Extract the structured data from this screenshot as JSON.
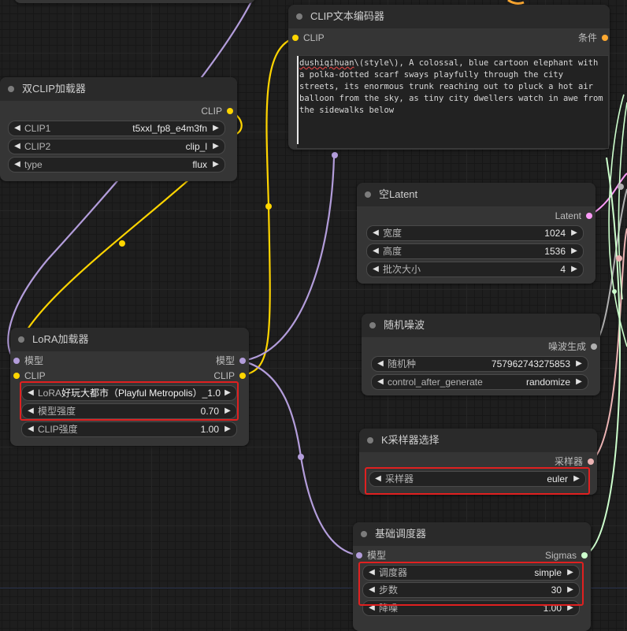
{
  "nodes": {
    "clip_text_encoder": {
      "title": "CLIP文本编码器",
      "input_clip": "CLIP",
      "output_cond": "条件",
      "prompt_keyword": "dushiqihuan",
      "prompt_rest": "\\(style\\), A colossal, blue cartoon elephant with a polka-dotted scarf sways playfully through the city streets, its enormous trunk reaching out to pluck a hot air balloon from the sky, as tiny city dwellers watch in awe from the sidewalks below"
    },
    "dual_clip_loader": {
      "title": "双CLIP加载器",
      "output_clip": "CLIP",
      "clip1_label": "CLIP1",
      "clip1_value": "t5xxl_fp8_e4m3fn",
      "clip2_label": "CLIP2",
      "clip2_value": "clip_l",
      "type_label": "type",
      "type_value": "flux"
    },
    "empty_latent": {
      "title": "空Latent",
      "output_latent": "Latent",
      "width_label": "宽度",
      "width_value": "1024",
      "height_label": "高度",
      "height_value": "1536",
      "batch_label": "批次大小",
      "batch_value": "4"
    },
    "random_noise": {
      "title": "随机噪波",
      "output_noise": "噪波生成",
      "seed_label": "随机种",
      "seed_value": "757962743275853",
      "control_label": "control_after_generate",
      "control_value": "randomize"
    },
    "lora_loader": {
      "title": "LoRA加载器",
      "input_model": "模型",
      "input_clip": "CLIP",
      "output_model": "模型",
      "output_clip": "CLIP",
      "lora_label": "LoRA",
      "lora_value": "好玩大都市（Playful Metropolis）_1.0",
      "model_strength_label": "模型强度",
      "model_strength_value": "0.70",
      "clip_strength_label": "CLIP强度",
      "clip_strength_value": "1.00"
    },
    "ksampler_select": {
      "title": "K采样器选择",
      "output_sampler": "采样器",
      "sampler_label": "采样器",
      "sampler_value": "euler"
    },
    "basic_scheduler": {
      "title": "基础调度器",
      "input_model": "模型",
      "output_sigmas": "Sigmas",
      "scheduler_label": "调度器",
      "scheduler_value": "simple",
      "steps_label": "步数",
      "steps_value": "30",
      "denoise_label": "降噪",
      "denoise_value": "1.00"
    }
  },
  "colors": {
    "clip_wire": "#ffd500",
    "model_wire": "#b39ddb",
    "latent_wire": "#ff9cf9",
    "noise_wire": "#b0b0b0",
    "sampler_wire": "#ecb4b4",
    "sigmas_wire": "#cdffcd",
    "cond_wire": "#ffa931",
    "highlight": "#e02020"
  },
  "arrows": {
    "left": "◀",
    "right": "▶"
  }
}
